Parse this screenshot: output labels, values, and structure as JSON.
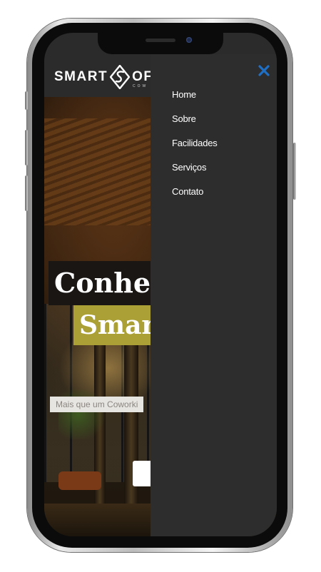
{
  "site": {
    "logo_text_left": "SMART",
    "logo_text_right": "OF",
    "logo_sub": "COW"
  },
  "hero": {
    "title_line1": "Conheç",
    "title_line2": "Smar",
    "subtitle": "Mais que um Coworki",
    "cta_label": ""
  },
  "menu": {
    "close_label": "×",
    "items": [
      {
        "label": "Home"
      },
      {
        "label": "Sobre"
      },
      {
        "label": "Facilidades"
      },
      {
        "label": "Serviços"
      },
      {
        "label": "Contato"
      }
    ]
  },
  "colors": {
    "accent": "#1f6fc5",
    "menu_bg": "#2d2d2d",
    "title_highlight": "#aaa036"
  }
}
